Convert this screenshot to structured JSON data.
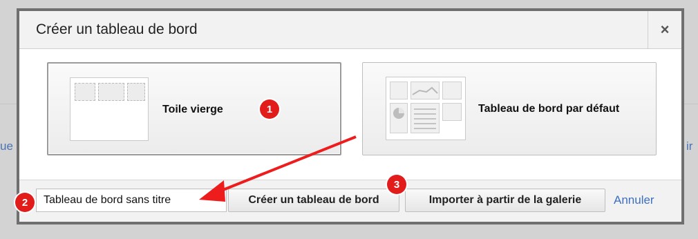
{
  "background": {
    "left_link_fragment": "ue",
    "right_link_fragment": "ir"
  },
  "dialog": {
    "title": "Créer un tableau de bord",
    "close_icon": "close-icon",
    "close_glyph": "×"
  },
  "options": {
    "blank": {
      "label": "Toile vierge",
      "selected": true
    },
    "default": {
      "label": "Tableau de bord par défaut",
      "selected": false
    }
  },
  "footer": {
    "name_value": "Tableau de bord sans titre",
    "create_label": "Créer un tableau de bord",
    "import_label": "Importer à partir de la galerie",
    "cancel_label": "Annuler"
  },
  "annotations": {
    "badge_1": "1",
    "badge_2": "2",
    "badge_3": "3",
    "color": "#e21b1b"
  }
}
